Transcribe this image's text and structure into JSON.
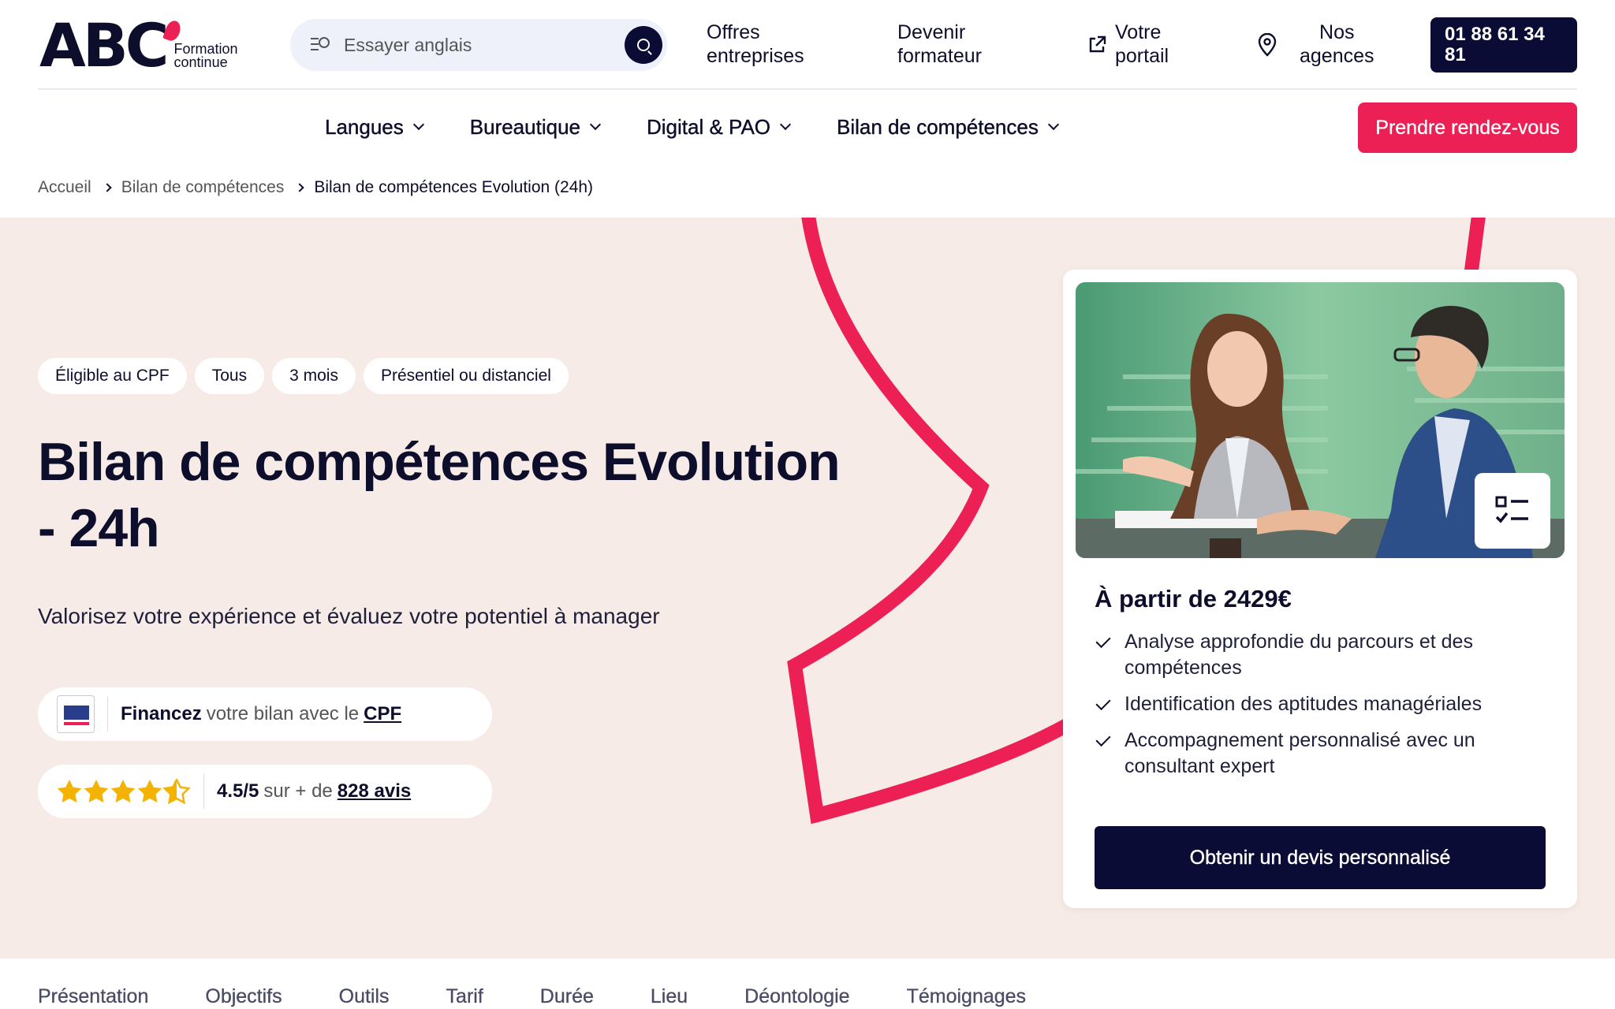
{
  "header": {
    "logo_text": "ABC",
    "logo_sub_1": "Formation",
    "logo_sub_2": "continue",
    "search_placeholder": "Essayer anglais",
    "links": {
      "offres_1": "Offres",
      "offres_2": "entreprises",
      "devenir_1": "Devenir",
      "devenir_2": "formateur",
      "portail_1": "Votre",
      "portail_2": "portail",
      "agences_1": "Nos",
      "agences_2": "agences"
    },
    "phone_1": "01 88 61 34",
    "phone_2": "81"
  },
  "nav": {
    "items": [
      {
        "label": "Langues"
      },
      {
        "label": "Bureautique"
      },
      {
        "label": "Digital & PAO"
      },
      {
        "label": "Bilan de compétences"
      }
    ],
    "cta": "Prendre rendez-vous"
  },
  "breadcrumb": {
    "home": "Accueil",
    "parent": "Bilan de compétences",
    "current": "Bilan de compétences Evolution (24h)"
  },
  "hero": {
    "tags": [
      "Éligible au CPF",
      "Tous",
      "3 mois",
      "Présentiel ou distanciel"
    ],
    "title_line1": "Bilan de compétences Evolution",
    "title_line2": "- 24h",
    "subtitle": "Valorisez votre expérience et évaluez votre potentiel à manager",
    "cpf": {
      "bold": "Financez",
      "text": "votre bilan avec le",
      "link": "CPF"
    },
    "rating": {
      "score": "4.5/5",
      "text": "sur + de",
      "link": "828 avis",
      "value": 4.5,
      "max": 5
    }
  },
  "card": {
    "price": "À partir de 2429€",
    "features": [
      "Analyse approfondie du parcours et des compétences",
      "Identification des aptitudes managériales",
      "Accompagnement personnalisé avec un consultant expert"
    ],
    "cta": "Obtenir un devis personnalisé"
  },
  "tabs": [
    "Présentation",
    "Objectifs",
    "Outils",
    "Tarif",
    "Durée",
    "Lieu",
    "Déontologie",
    "Témoignages"
  ],
  "colors": {
    "navy": "#0b0c36",
    "accent": "#ec2055",
    "hero_bg": "#f6ebe6"
  }
}
